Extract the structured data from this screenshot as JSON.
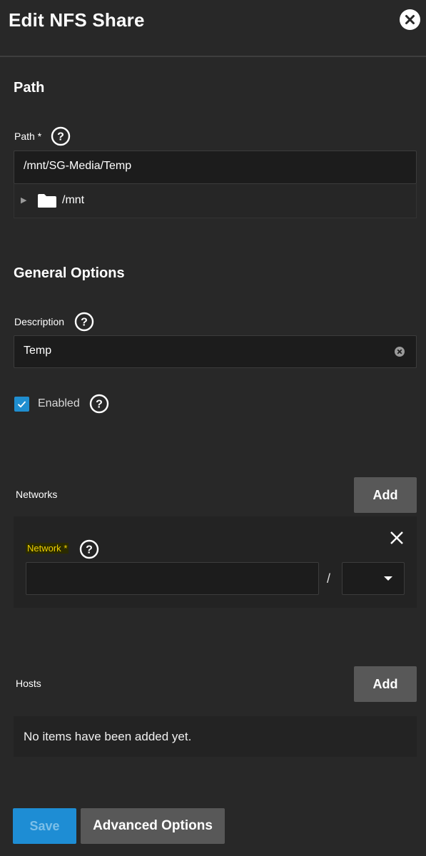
{
  "header": {
    "title": "Edit NFS Share",
    "close_icon": "close-circle-icon"
  },
  "path_section": {
    "title": "Path",
    "field_label": "Path",
    "required_mark": "*",
    "value": "/mnt/SG-Media/Temp",
    "tree": {
      "expand_icon": "triangle-right-icon",
      "folder_icon": "folder-icon",
      "label": "/mnt"
    }
  },
  "general_section": {
    "title": "General Options",
    "description": {
      "label": "Description",
      "value": "Temp"
    },
    "enabled": {
      "label": "Enabled",
      "checked": true
    }
  },
  "networks": {
    "label": "Networks",
    "add_label": "Add",
    "item": {
      "label": "Network",
      "required_mark": "*",
      "value": "",
      "separator": "/",
      "mask_value": ""
    }
  },
  "hosts": {
    "label": "Hosts",
    "add_label": "Add",
    "empty_text": "No items have been added yet."
  },
  "footer": {
    "save_label": "Save",
    "advanced_label": "Advanced Options"
  },
  "colors": {
    "accent": "#1e8dd4",
    "background": "#282828",
    "required_label": "#f0d000"
  }
}
